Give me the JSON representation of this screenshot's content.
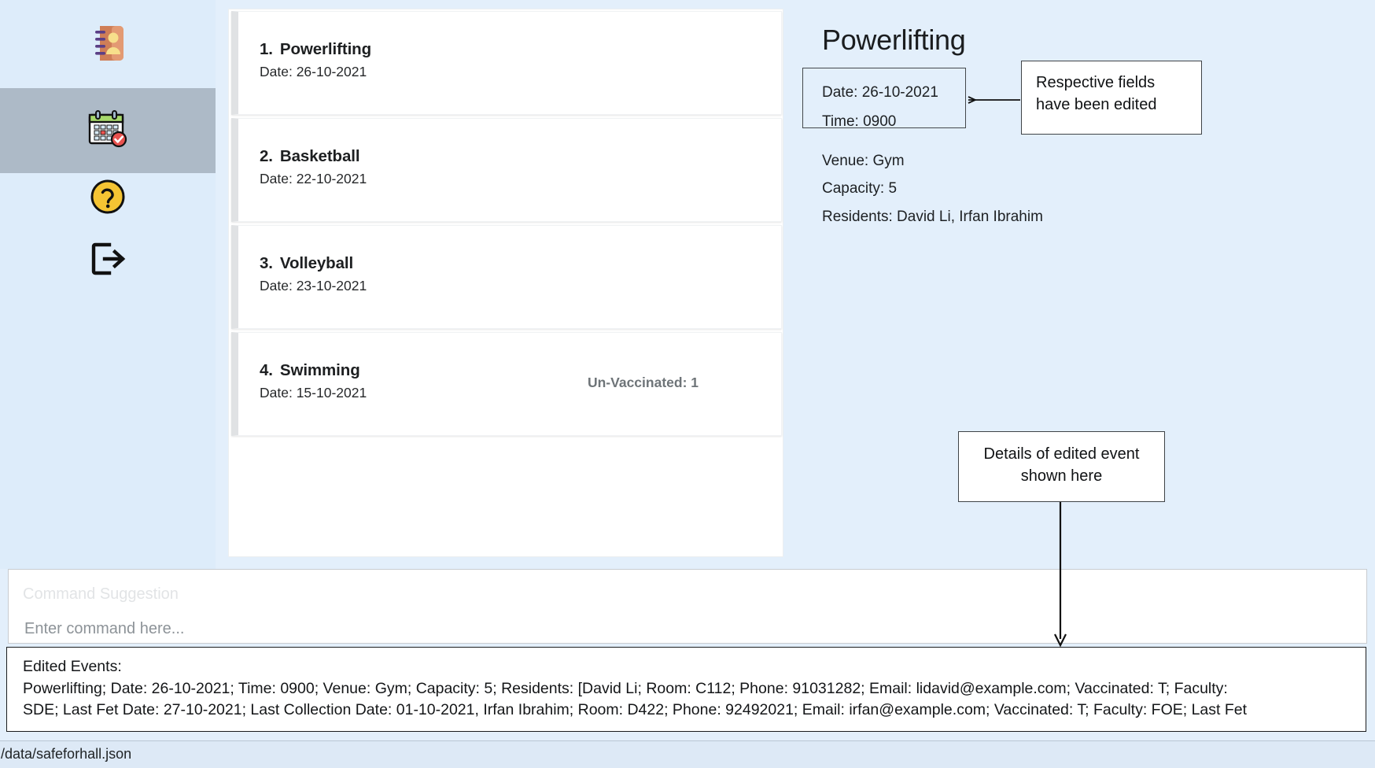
{
  "sidebar": {
    "items": [
      {
        "name": "contacts",
        "icon": "address-book-icon",
        "active": false
      },
      {
        "name": "calendar",
        "icon": "calendar-check-icon",
        "active": true
      },
      {
        "name": "help",
        "icon": "question-circle-icon",
        "active": false
      },
      {
        "name": "logout",
        "icon": "logout-icon",
        "active": false
      }
    ]
  },
  "event_list": {
    "items": [
      {
        "num": "1.",
        "title": "Powerlifting",
        "sub": "Date: 26-10-2021",
        "badge": ""
      },
      {
        "num": "2.",
        "title": "Basketball",
        "sub": "Date: 22-10-2021",
        "badge": ""
      },
      {
        "num": "3.",
        "title": "Volleyball",
        "sub": "Date: 23-10-2021",
        "badge": ""
      },
      {
        "num": "4.",
        "title": "Swimming",
        "sub": "Date: 15-10-2021",
        "badge": "Un-Vaccinated: 1"
      }
    ]
  },
  "detail": {
    "title": "Powerlifting",
    "date": "Date: 26-10-2021",
    "time": "Time: 0900",
    "venue": "Venue: Gym",
    "capacity": "Capacity: 5",
    "residents": "Residents: David Li, Irfan Ibrahim"
  },
  "annotations": {
    "fields_edited": "Respective fields have been edited",
    "details_shown": "Details of edited event shown here"
  },
  "command": {
    "suggestion": "Command Suggestion",
    "placeholder": "Enter command here..."
  },
  "result": {
    "line1": "Edited Events:",
    "line2": "Powerlifting; Date: 26-10-2021; Time: 0900; Venue: Gym; Capacity: 5; Residents: [David Li; Room: C112; Phone: 91031282; Email: lidavid@example.com; Vaccinated: T; Faculty:",
    "line3": "SDE; Last Fet Date: 27-10-2021; Last Collection Date: 01-10-2021, Irfan Ibrahim; Room: D422; Phone: 92492021; Email: irfan@example.com; Vaccinated: T; Faculty: FOE; Last Fet"
  },
  "status": {
    "path": "./data/safeforhall.json"
  },
  "colors": {
    "app_background": "#e3effb",
    "sidebar_active": "#adbac7",
    "panel_white": "#ffffff",
    "card_left_strip": "#e0e2e4",
    "annotation_border": "#3f4347",
    "badge_text": "#6e7478"
  }
}
